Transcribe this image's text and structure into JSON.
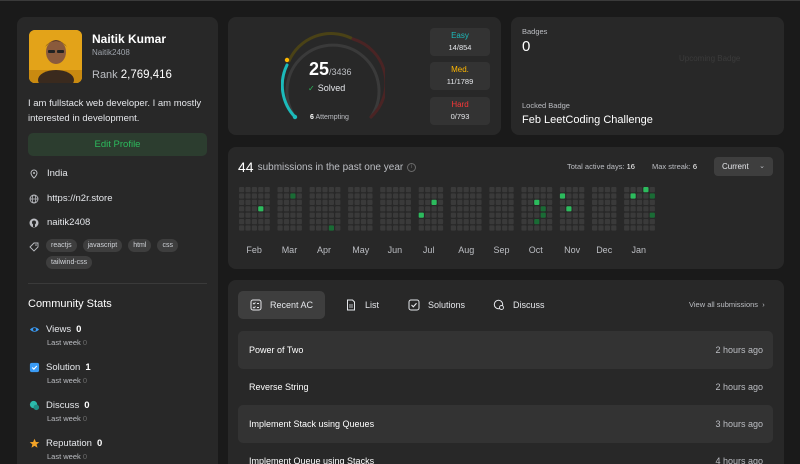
{
  "profile": {
    "name": "Naitik Kumar",
    "handle": "Naitik2408",
    "rank_label": "Rank",
    "rank": "2,769,416",
    "bio": "I am fullstack web developer. I am mostly interested in development.",
    "edit_label": "Edit Profile",
    "location": "India",
    "website": "https://n2r.store",
    "github": "naitik2408",
    "skills": [
      "reactjs",
      "javascript",
      "html",
      "css",
      "tailwind-css"
    ]
  },
  "community": {
    "title": "Community Stats",
    "last_week_label": "Last week",
    "stats": [
      {
        "label": "Views",
        "value": "0",
        "last_week": "0",
        "color": "#3a9bf5"
      },
      {
        "label": "Solution",
        "value": "1",
        "last_week": "0",
        "color": "#3a9bf5"
      },
      {
        "label": "Discuss",
        "value": "0",
        "last_week": "0",
        "color": "#2cbbab"
      },
      {
        "label": "Reputation",
        "value": "0",
        "last_week": "0",
        "color": "#f4a427"
      }
    ]
  },
  "solved": {
    "count": "25",
    "total": "/3436",
    "label": "Solved",
    "attempting_count": "6",
    "attempting_label": "Attempting",
    "easy": {
      "label": "Easy",
      "value": "14/854",
      "color": "#1cbaba"
    },
    "medium": {
      "label": "Med.",
      "value": "11/1789",
      "color": "#ffb700"
    },
    "hard": {
      "label": "Hard",
      "value": "0/793",
      "color": "#f63737"
    }
  },
  "badges": {
    "label": "Badges",
    "count": "0",
    "ghost_text": "Upcoming Badge",
    "locked_label": "Locked Badge",
    "locked_name": "Feb LeetCoding Challenge"
  },
  "heatmap": {
    "count": "44",
    "title": "submissions in the past one year",
    "active_days_label": "Total active days:",
    "active_days": "16",
    "max_streak_label": "Max streak:",
    "max_streak": "6",
    "period": "Current",
    "months": [
      "Feb",
      "Mar",
      "Apr",
      "May",
      "Jun",
      "Jul",
      "Aug",
      "Sep",
      "Oct",
      "Nov",
      "Dec",
      "Jan"
    ],
    "active_cells": [
      {
        "month": 0,
        "week": 3,
        "day": 3,
        "level": 2
      },
      {
        "month": 1,
        "week": 2,
        "day": 1,
        "level": 1
      },
      {
        "month": 2,
        "week": 3,
        "day": 6,
        "level": 1
      },
      {
        "month": 5,
        "week": 0,
        "day": 4,
        "level": 2
      },
      {
        "month": 5,
        "week": 2,
        "day": 2,
        "level": 2
      },
      {
        "month": 8,
        "week": 2,
        "day": 2,
        "level": 2
      },
      {
        "month": 8,
        "week": 3,
        "day": 4,
        "level": 1
      },
      {
        "month": 8,
        "week": 2,
        "day": 5,
        "level": 1
      },
      {
        "month": 8,
        "week": 3,
        "day": 3,
        "level": 1
      },
      {
        "month": 9,
        "week": 0,
        "day": 1,
        "level": 2
      },
      {
        "month": 9,
        "week": 1,
        "day": 3,
        "level": 2
      },
      {
        "month": 11,
        "week": 1,
        "day": 1,
        "level": 2
      },
      {
        "month": 11,
        "week": 3,
        "day": 0,
        "level": 2
      },
      {
        "month": 11,
        "week": 4,
        "day": 1,
        "level": 1
      },
      {
        "month": 11,
        "week": 4,
        "day": 4,
        "level": 1
      },
      {
        "month": 11,
        "week": 3,
        "day": 7,
        "level": 1
      }
    ]
  },
  "recent": {
    "tabs": [
      "Recent AC",
      "List",
      "Solutions",
      "Discuss"
    ],
    "view_all": "View all submissions",
    "items": [
      {
        "title": "Power of Two",
        "ago": "2 hours ago"
      },
      {
        "title": "Reverse String",
        "ago": "2 hours ago"
      },
      {
        "title": "Implement Stack using Queues",
        "ago": "3 hours ago"
      },
      {
        "title": "Implement Queue using Stacks",
        "ago": "4 hours ago"
      }
    ]
  }
}
